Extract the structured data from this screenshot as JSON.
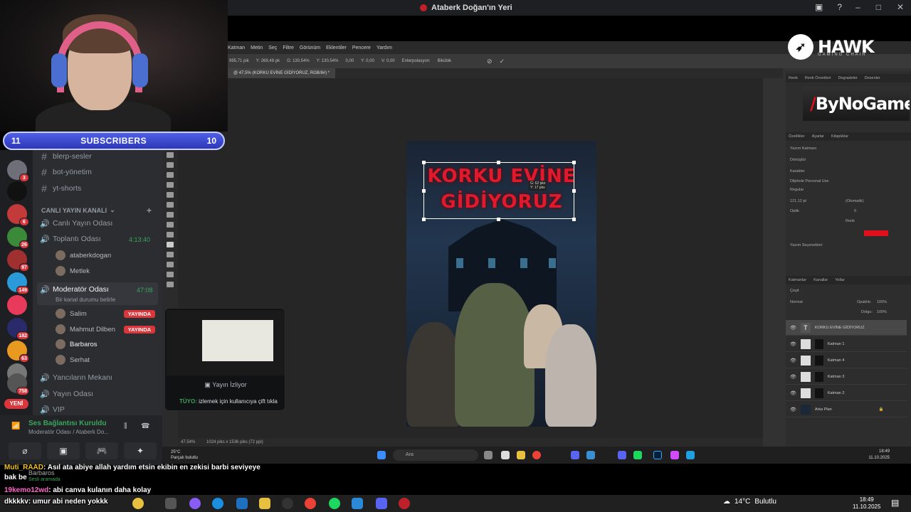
{
  "window": {
    "title": "Ataberk Doğan'ın Yeri"
  },
  "overlay": {
    "subs_left": "11",
    "subs_label": "SUBSCRIBERS",
    "subs_right": "10",
    "hawk_name": "HAWK",
    "hawk_sub": "GAMING CHAIR",
    "bynogame": "ByNoGame"
  },
  "discord": {
    "servers": [
      {
        "badge": "3"
      },
      {
        "badge": ""
      },
      {
        "badge": "6"
      },
      {
        "badge": "26"
      },
      {
        "badge": "97"
      },
      {
        "badge": "149"
      },
      {
        "badge": ""
      },
      {
        "badge": "182"
      },
      {
        "badge": "63"
      },
      {
        "badge": ""
      },
      {
        "badge": "758"
      }
    ],
    "servers_new": "YENİ",
    "text_channels": [
      "blerp-sesler",
      "bot-yönetim",
      "yt-shorts"
    ],
    "category": "CANLI YAYIN KANALI",
    "voice": {
      "canli": "Canlı Yayın Odası",
      "toplanti": "Toplantı Odası",
      "toplanti_time": "4:13:40",
      "toplanti_users": [
        "ataberkdogan",
        "Metlek"
      ],
      "moderator": "Moderatör Odası",
      "moderator_time": "47:08",
      "moderator_status": "Bir kanal durumu belirle",
      "mod_users": [
        {
          "name": "Salim",
          "live": "YAYINDA"
        },
        {
          "name": "Mahmut Dilben",
          "live": "YAYINDA"
        },
        {
          "name": "Barbaros",
          "live": ""
        },
        {
          "name": "Serhat",
          "live": ""
        }
      ],
      "yancilar": "Yancıların Mekanı",
      "yayin": "Yayın Odası",
      "vip": "VIP"
    },
    "panel": {
      "status": "Ses Bağlantısı Kuruldu",
      "sub": "Moderatör Odası / Ataberk Do..."
    },
    "preview": {
      "watching": "Yayın İzliyor",
      "tip_label": "TÜYO:",
      "tip_text": "izlemek için kullanıcıya çift tıkla"
    }
  },
  "chat": [
    {
      "user": "Muti_RAAD",
      "text": ": Asıl ata abiye allah yardım etsin ekibin en zekisi barbi seviyeye"
    },
    {
      "user": "",
      "text": "bak be"
    },
    {
      "user": "19kemo12wd",
      "text": ": abi canva kulanın daha kolay"
    },
    {
      "user": "dkkkkv",
      "text": ": umur abi neden yokkk"
    }
  ],
  "chat_overlap": {
    "name": "Barbaros",
    "status": "Sesli aramada"
  },
  "photoshop": {
    "menu": [
      "Katman",
      "Metin",
      "Seç",
      "Filtre",
      "Görünüm",
      "Eklentiler",
      "Pencere",
      "Yardım"
    ],
    "tab": "@ 47,5% (KORKU EVİNE GİDİYORUZ, RGB/8#) *",
    "options": [
      "995,71 pik",
      "Y: 269,48 pk",
      "G: 130,54%",
      "Y: 130,54%",
      "0,00",
      "Y: 0,00",
      "V: 0,00",
      "Enterpolasyon:",
      "Bikübik"
    ],
    "zoom": "47.54%",
    "doc_size": "1024 piks x 1536 piks (72 ppi)",
    "poster_title_1": "KORKU EVİNE",
    "poster_title_2": "GİDİYORUZ",
    "size_tip_w": "G: 62 pks",
    "size_tip_h": "Y: 17 pks",
    "right": {
      "tabs_top": [
        "Renk",
        "Renk Örnekleri",
        "Degradeler",
        "Desenler"
      ],
      "tabs_props": [
        "Özellikler",
        "Ayarlar",
        "Kitaplıklar"
      ],
      "text_layer": "Yazım Katmanı",
      "transform": "Dönüştür",
      "char": "Karakter",
      "font": "Dilphole Personal Use",
      "font_style": "Regular",
      "font_size": "121,12 pt",
      "leading": "(Otomatik)",
      "kerning": "Optik",
      "tracking": "0",
      "color_label": "Renk",
      "typo": "Yazım Seçenekleri",
      "tabs_layers": [
        "Katmanlar",
        "Kanallar",
        "Yollar"
      ],
      "blend": "Normal",
      "opacity_label": "Opaklık:",
      "opacity": "100%",
      "fill_label": "Dolgu:",
      "fill": "100%",
      "search": "Çeşit",
      "layers": [
        "KORKU EVİNE GİDİYORUZ",
        "Katman 1",
        "Katman 4",
        "Katman 3",
        "Katman 2",
        "Arka Plan"
      ]
    }
  },
  "inner_taskbar": {
    "temp": "25°C",
    "weather": "Parçalı bulutlu",
    "search": "Ara",
    "time": "18:49",
    "date": "11.10.2025"
  },
  "taskbar": {
    "temp": "14°C",
    "weather": "Bulutlu",
    "time": "18:49",
    "date": "11.10.2025"
  },
  "colors": {
    "discord_green": "#3ba55c",
    "discord_red": "#da373c",
    "poster_red": "#e0192d"
  }
}
